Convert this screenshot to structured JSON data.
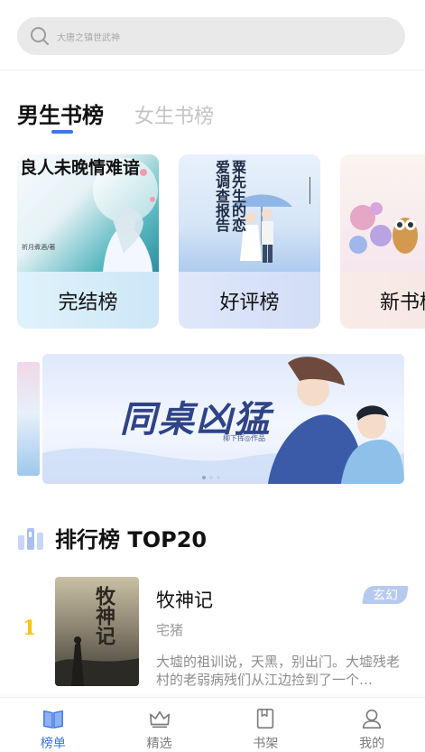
{
  "search": {
    "placeholder": "大唐之镇世武神"
  },
  "gender_tabs": [
    {
      "label": "男生书榜",
      "active": true
    },
    {
      "label": "女生书榜",
      "active": false
    }
  ],
  "rank_cards": [
    {
      "label": "完结榜",
      "cover_title": "良人未晚情难谙",
      "cover_author": "祈月煮酒/著"
    },
    {
      "label": "好评榜",
      "cover_title": "粟先生的恋爱调查报告"
    },
    {
      "label": "新书榜"
    }
  ],
  "banner": {
    "title": "同桌凶猛",
    "subtitle": "柳下挥◎作品"
  },
  "ranking": {
    "title": "排行榜 TOP20",
    "books": [
      {
        "rank": "1",
        "title": "牧神记",
        "author": "宅猪",
        "tag": "玄幻",
        "description": "大墟的祖训说，天黑，别出门。大墟残老村的老弱病残们从江边捡到了一个…",
        "cover_text": "牧神记"
      }
    ]
  },
  "bottom_nav": [
    {
      "label": "榜单",
      "icon": "book-open-icon",
      "active": true
    },
    {
      "label": "精选",
      "icon": "crown-icon",
      "active": false
    },
    {
      "label": "书架",
      "icon": "bookshelf-icon",
      "active": false
    },
    {
      "label": "我的",
      "icon": "user-icon",
      "active": false
    }
  ],
  "colors": {
    "accent": "#3b73e6",
    "rank_gold": "#f5c518",
    "tag_bg": "#b7c9ef"
  }
}
